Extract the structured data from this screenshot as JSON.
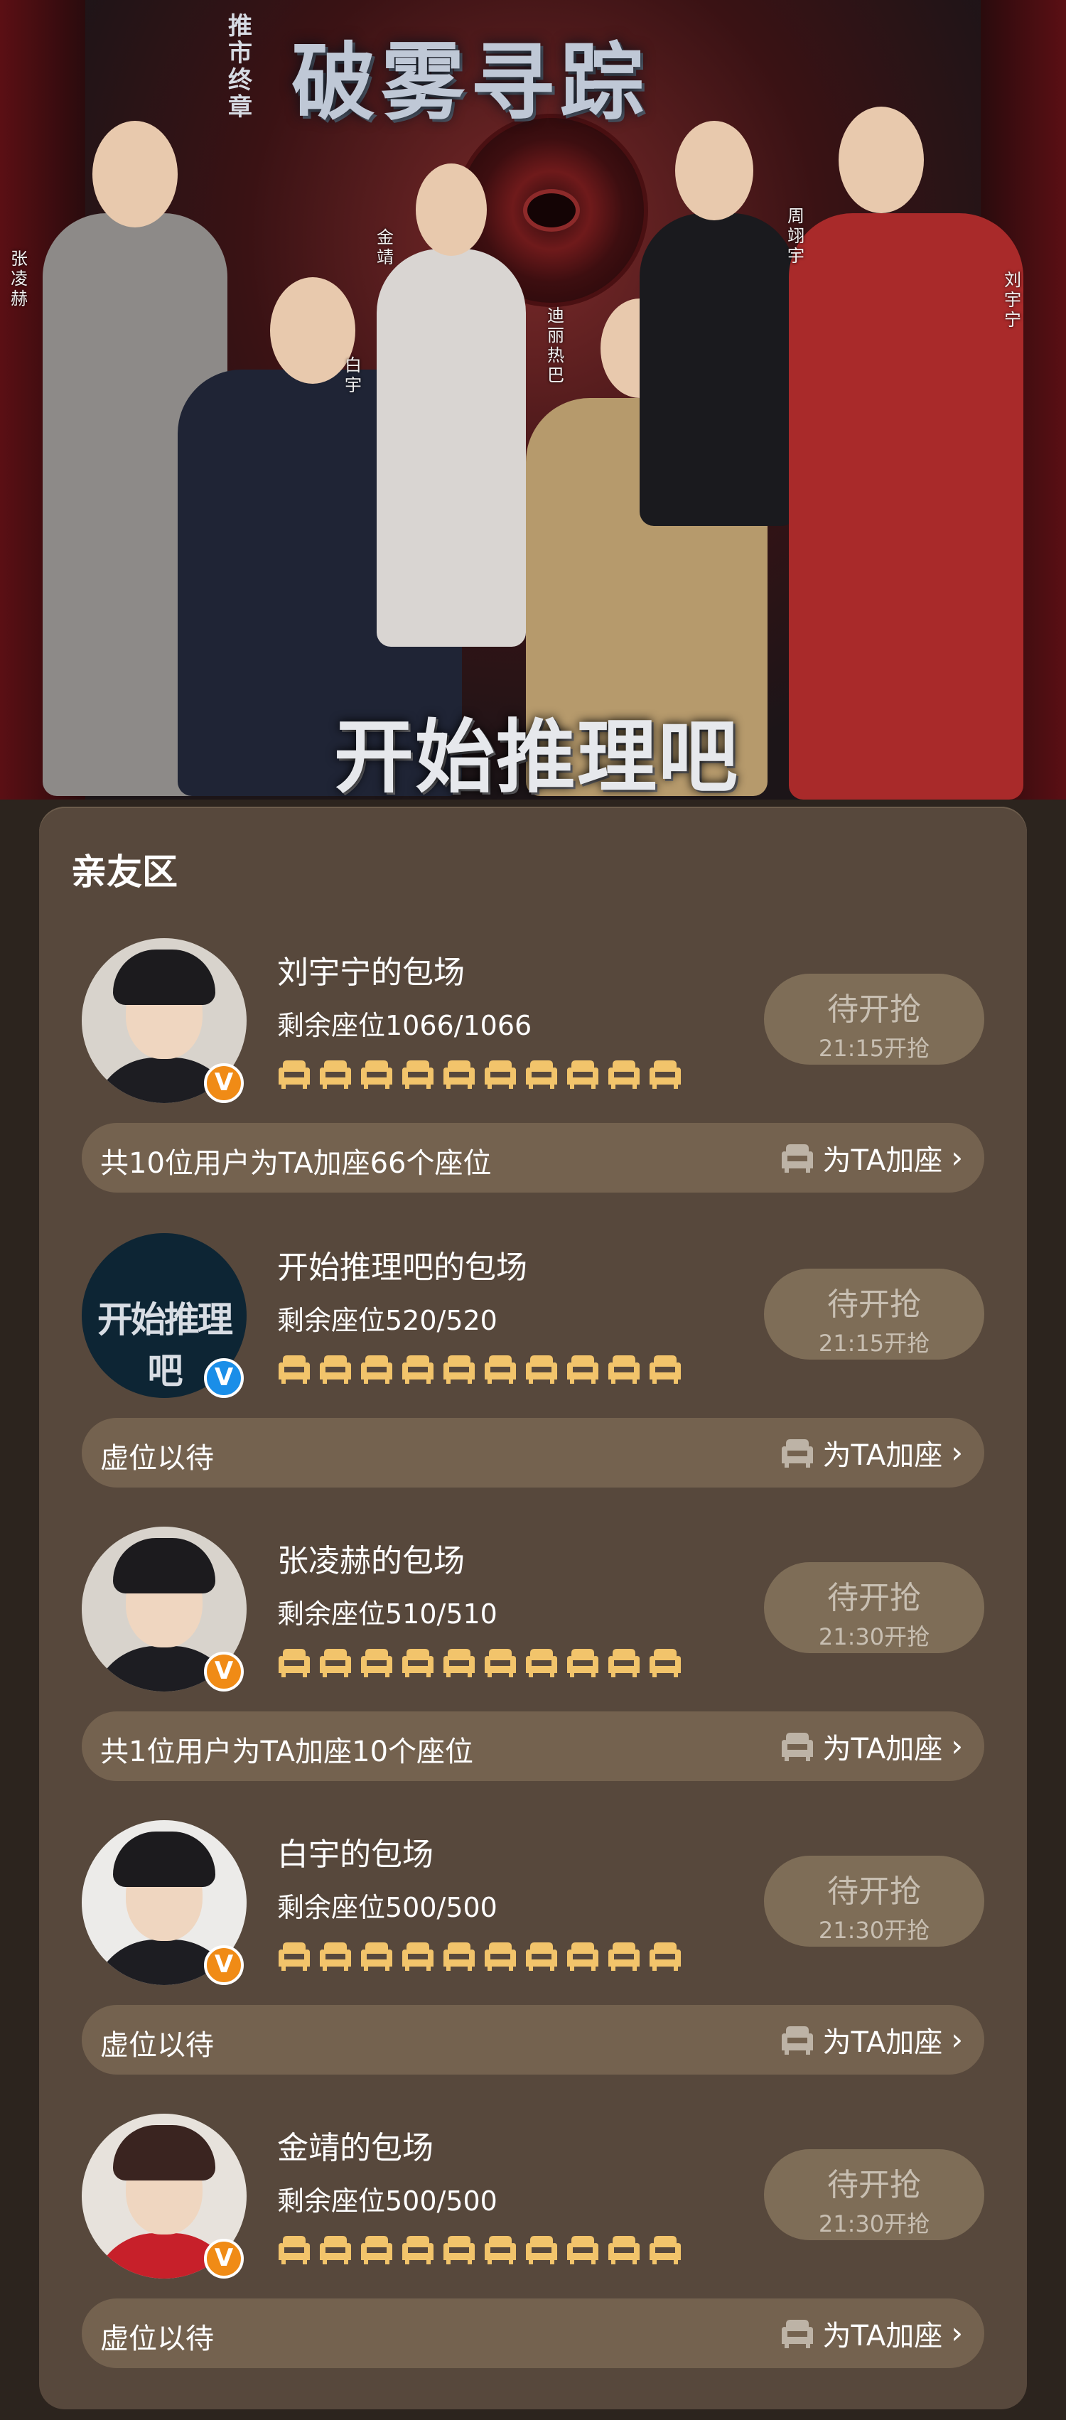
{
  "banner": {
    "title": "破雾寻踪",
    "tag": "推市终章",
    "subtitle": "开始推理吧",
    "names": [
      "张凌赫",
      "白宇",
      "金靖",
      "迪丽热巴",
      "周翊宇",
      "刘宇宁"
    ]
  },
  "section": {
    "title": "亲友区",
    "add_seat_label": "为TA加座",
    "cards": [
      {
        "name": "刘宇宁的包场",
        "seats": "剩余座位1066/1066",
        "badge": "V",
        "button_main": "待开抢",
        "button_time": "21:15开抢",
        "bar_text": "共10位用户为TA加座66个座位"
      },
      {
        "name": "开始推理吧的包场",
        "seats": "剩余座位520/520",
        "badge": "V",
        "logo_text": "开始推理吧",
        "button_main": "待开抢",
        "button_time": "21:15开抢",
        "bar_text": "虚位以待"
      },
      {
        "name": "张凌赫的包场",
        "seats": "剩余座位510/510",
        "badge": "V",
        "button_main": "待开抢",
        "button_time": "21:30开抢",
        "bar_text": "共1位用户为TA加座10个座位"
      },
      {
        "name": "白宇的包场",
        "seats": "剩余座位500/500",
        "badge": "V",
        "button_main": "待开抢",
        "button_time": "21:30开抢",
        "bar_text": "虚位以待"
      },
      {
        "name": "金靖的包场",
        "seats": "剩余座位500/500",
        "badge": "V",
        "button_main": "待开抢",
        "button_time": "21:30开抢",
        "bar_text": "虚位以待"
      }
    ]
  },
  "colors": {
    "seat_icon": "#f2c46b",
    "badge_orange": "#f08b16",
    "badge_blue": "#1a8ee8",
    "card_bg": "#57483c"
  }
}
